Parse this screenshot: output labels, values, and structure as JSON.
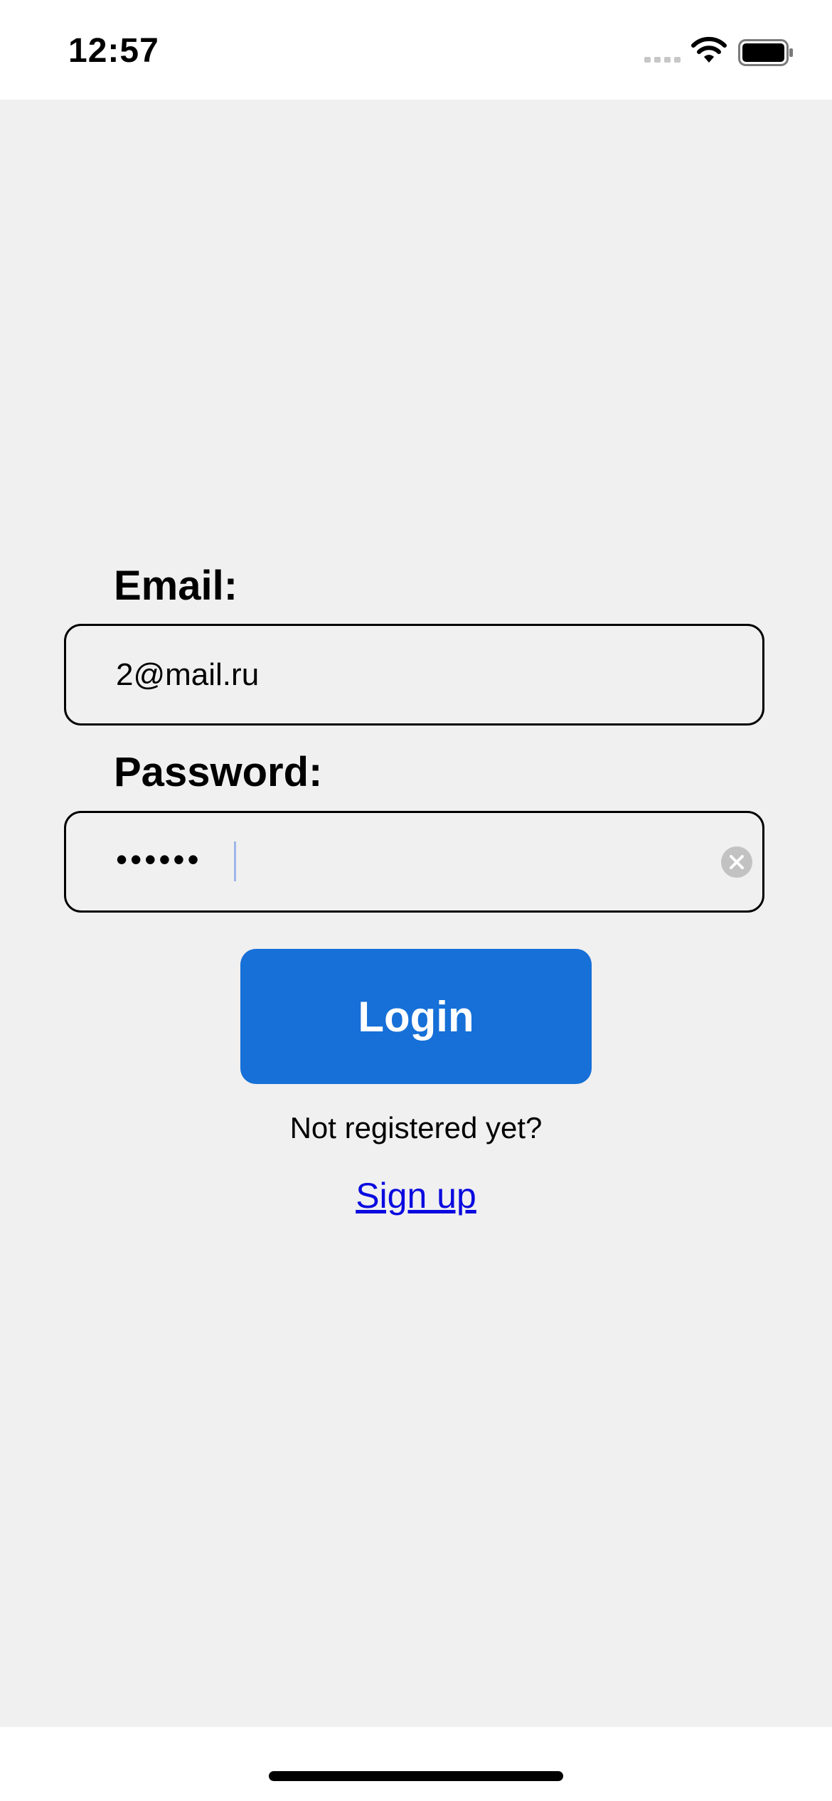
{
  "status_bar": {
    "time": "12:57",
    "icons": [
      "signal-icon",
      "wifi-icon",
      "battery-icon"
    ]
  },
  "login_form": {
    "email_label": "Email:",
    "email_value": "2@mail.ru",
    "password_label": "Password:",
    "password_value": "••••••",
    "login_button_label": "Login",
    "prompt_text": "Not registered yet?",
    "signup_link_label": "Sign up"
  },
  "colors": {
    "background": "#f0f0f0",
    "button": "#1670d7",
    "link": "#0a0ae0"
  }
}
